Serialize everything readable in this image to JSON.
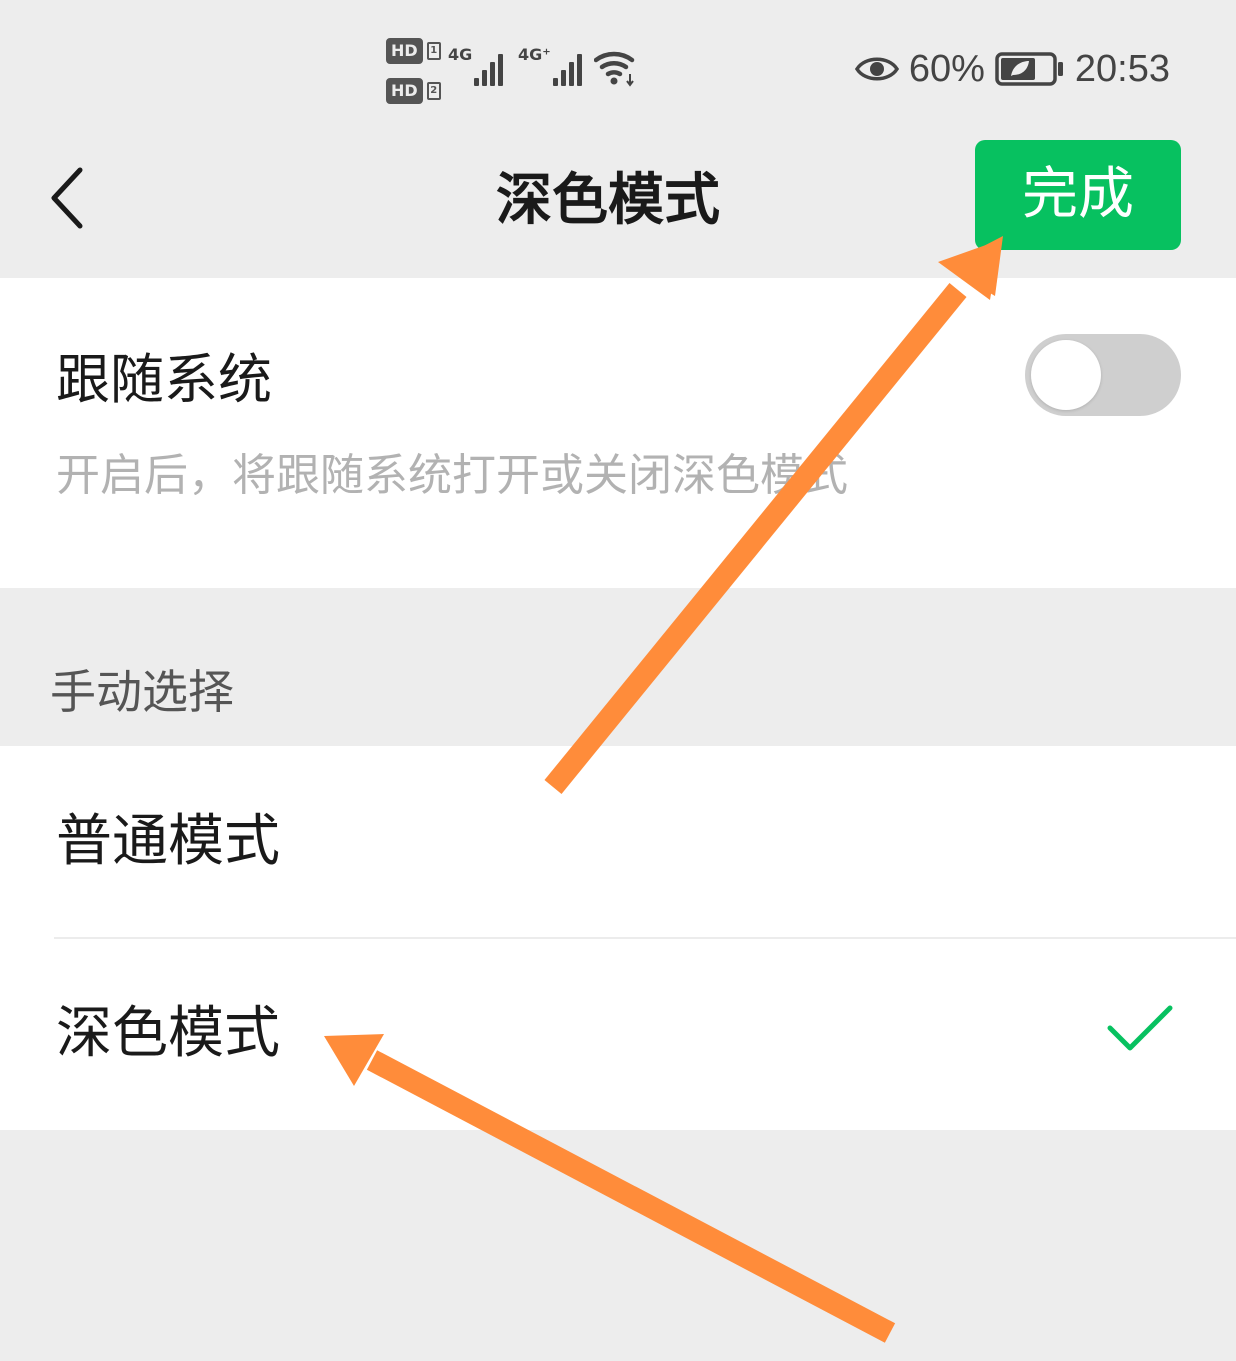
{
  "status_bar": {
    "sim1_badge": "HD",
    "sim1_no": "1",
    "sim2_badge": "HD",
    "sim2_no": "2",
    "network1": "4G",
    "network2": "4G⁺",
    "battery_percent": "60%",
    "time": "20:53",
    "icons": [
      "eye-icon",
      "wifi-icon",
      "battery-icon"
    ]
  },
  "nav": {
    "title": "深色模式",
    "done_label": "完成",
    "back_icon": "chevron-left-icon"
  },
  "follow_system": {
    "title": "跟随系统",
    "description": "开启后，将跟随系统打开或关闭深色模式",
    "enabled": false
  },
  "manual": {
    "header": "手动选择",
    "options": [
      {
        "label": "普通模式",
        "selected": false
      },
      {
        "label": "深色模式",
        "selected": true
      }
    ]
  },
  "colors": {
    "accent": "#07c160",
    "annotation_arrow": "#ff8c3a",
    "background": "#ededed",
    "card": "#ffffff"
  }
}
